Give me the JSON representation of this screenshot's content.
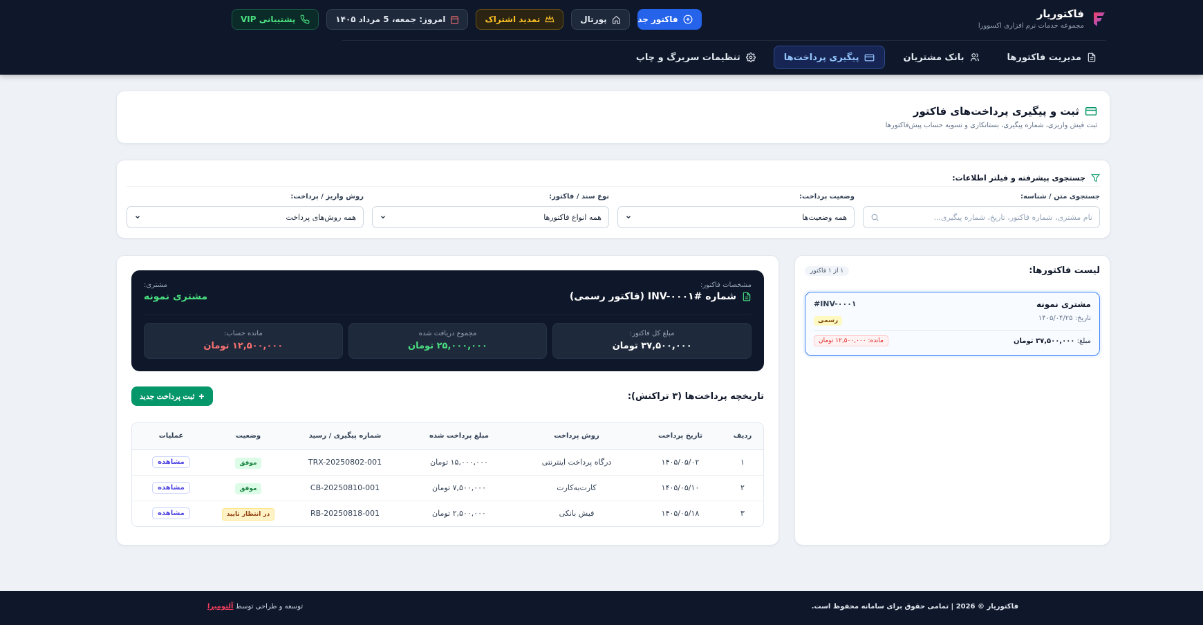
{
  "brand": {
    "name": "فاکتوریار",
    "subtitle": "مجموعه خدمات نرم افزاری اکسوورا"
  },
  "topbar": {
    "support": "پشتیبانی VIP",
    "date": "امروز: جمعه، 5 مرداد ۱۴۰۵",
    "renew": "تمدید اشتراک",
    "portal": "پورتال",
    "new_invoice": "فاکتور جدید"
  },
  "nav": {
    "items": [
      {
        "label": "مدیریت فاکتورها",
        "icon": "document-icon"
      },
      {
        "label": "بانک مشتریان",
        "icon": "users-icon"
      },
      {
        "label": "پیگیری پرداخت‌ها",
        "icon": "card-icon"
      },
      {
        "label": "تنظیمات سربرگ و چاپ",
        "icon": "gear-icon"
      }
    ]
  },
  "page": {
    "title": "ثبت و پیگیری پرداخت‌های فاکتور",
    "subtitle": "ثبت فیش واریزی، شماره پیگیری، بستانکاری و تسویه حساب پیش‌فاکتورها"
  },
  "filters": {
    "heading": "جستجوی پیشرفته و فیلتر اطلاعات:",
    "search": {
      "label": "جستجوی متن / شناسه:",
      "placeholder": "نام مشتری، شماره فاکتور، تاریخ، شماره پیگیری..."
    },
    "status": {
      "label": "وضعیت پرداخت:",
      "value": "همه وضعیت‌ها"
    },
    "doc_type": {
      "label": "نوع سند / فاکتور:",
      "value": "همه انواع فاکتورها"
    },
    "method": {
      "label": "روش واریز / پرداخت:",
      "value": "همه روش‌های پرداخت"
    }
  },
  "invoice_list": {
    "title": "لیست فاکتورها:",
    "count": "۱ از ۱ فاکتور",
    "items": [
      {
        "customer": "مشتری نمونه",
        "number": "#INV-۰۰۰۱",
        "date": "تاریخ: ۱۴۰۵/۰۴/۲۵",
        "tag": "رسمی",
        "amount_label": "مبلغ:",
        "amount": "۳۷,۵۰۰,۰۰۰ تومان",
        "remaining": "مانده: ۱۲,۵۰۰,۰۰۰ تومان"
      }
    ]
  },
  "detail": {
    "spec_label": "مشخصات فاکتور:",
    "invoice_title": "شماره INV-۰۰۰۱# (فاکتور رسمی)",
    "customer_label": "مشتری:",
    "customer": "مشتری نمونه",
    "stats": [
      {
        "label": "مبلغ کل فاکتور:",
        "value": "۳۷,۵۰۰,۰۰۰ تومان",
        "color": "#ffffff"
      },
      {
        "label": "مجموع دریافت شده",
        "value": "۲۵,۰۰۰,۰۰۰ تومان",
        "color": "#4ade80"
      },
      {
        "label": "مانده حساب:",
        "value": "۱۲,۵۰۰,۰۰۰ تومان",
        "color": "#f87171"
      }
    ],
    "history_title": "تاریخچه پرداخت‌ها (۳ تراکنش):",
    "add_payment": "ثبت پرداخت جدید"
  },
  "payments": {
    "columns": [
      "ردیف",
      "تاریخ پرداخت",
      "روش پرداخت",
      "مبلغ پرداخت شده",
      "شماره پیگیری / رسید",
      "وضعیت",
      "عملیات"
    ],
    "rows": [
      {
        "idx": "۱",
        "date": "۱۴۰۵/۰۵/۰۲",
        "method": "درگاه پرداخت اینترنتی",
        "amount": "۱۵,۰۰۰,۰۰۰ تومان",
        "ref": "TRX-20250802-001",
        "status": "موفق",
        "status_kind": "ok",
        "action": "مشاهده"
      },
      {
        "idx": "۲",
        "date": "۱۴۰۵/۰۵/۱۰",
        "method": "کارت‌به‌کارت",
        "amount": "۷,۵۰۰,۰۰۰ تومان",
        "ref": "CB-20250810-001",
        "status": "موفق",
        "status_kind": "ok",
        "action": "مشاهده"
      },
      {
        "idx": "۳",
        "date": "۱۴۰۵/۰۵/۱۸",
        "method": "فیش بانکی",
        "amount": "۲,۵۰۰,۰۰۰ تومان",
        "ref": "RB-20250818-001",
        "status": "در انتظار تایید",
        "status_kind": "wait",
        "action": "مشاهده"
      }
    ]
  },
  "footer": {
    "copyright": "فاکتوریار © 2026 | تمامی حقوق برای سامانه محفوظ است.",
    "credit_prefix": "توسعه و طراحی توسط",
    "credit_brand": "آلتومیرا"
  },
  "colors": {
    "accent": "#2563eb",
    "header_bg": "#0f172a",
    "success": "#059669"
  }
}
